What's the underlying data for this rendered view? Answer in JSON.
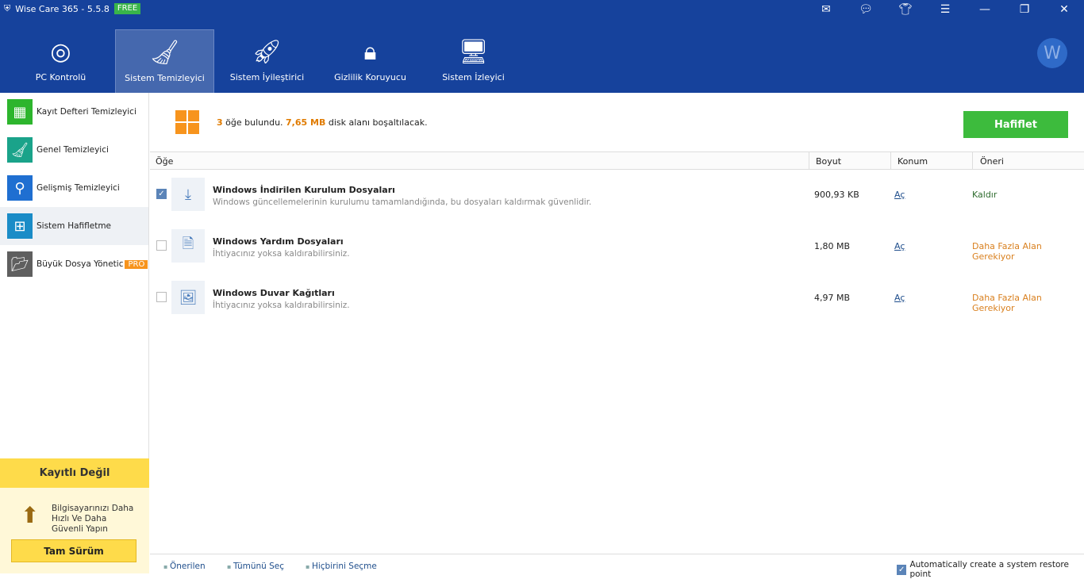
{
  "app": {
    "title": "Wise Care 365 - 5.5.8",
    "badge": "FREE",
    "logo_letter": "W"
  },
  "window_controls": [
    "mail-icon",
    "feedback-icon",
    "skin-icon",
    "menu-icon",
    "minimize-icon",
    "restore-icon",
    "close-icon"
  ],
  "tabs": [
    {
      "label": "PC Kontrolü",
      "icon": "radar-icon"
    },
    {
      "label": "Sistem Temizleyici",
      "icon": "broom-icon",
      "active": true
    },
    {
      "label": "Sistem İyileştirici",
      "icon": "rocket-icon"
    },
    {
      "label": "Gizlilik Koruyucu",
      "icon": "shield-lock-icon"
    },
    {
      "label": "Sistem İzleyici",
      "icon": "monitor-icon"
    }
  ],
  "sidebar": {
    "items": [
      {
        "label": "Kayıt Defteri Temizleyici",
        "color": "#2db52d"
      },
      {
        "label": "Genel Temizleyici",
        "color": "#1aa38a"
      },
      {
        "label": "Gelişmiş Temizleyici",
        "color": "#1f6fd1"
      },
      {
        "label": "Sistem Hafifletme",
        "color": "#1a8cc7",
        "active": true
      },
      {
        "label": "Büyük Dosya Yönetic",
        "color": "#5f5f5f",
        "badge": "PRO"
      }
    ],
    "register": "Kayıtlı Değil",
    "promo": "Bilgisayarınızı Daha Hızlı Ve Daha Güvenli Yapın",
    "full_version": "Tam Sürüm"
  },
  "summary": {
    "count": "3",
    "text1": " öğe bulundu. ",
    "size": "7,65 MB",
    "text2": " disk alanı boşaltılacak.",
    "button": "Hafiflet"
  },
  "columns": [
    "Öğe",
    "Boyut",
    "Konum",
    "Öneri"
  ],
  "rows": [
    {
      "name": "Windows İndirilen Kurulum Dosyaları",
      "desc": "Windows güncellemelerinin kurulumu tamamlandığında, bu dosyaları kaldırmak güvenlidir.",
      "size": "900,93 KB",
      "location": "Aç",
      "suggestion": "Kaldır",
      "suggestion_color": "#2e6b2e",
      "checked": true
    },
    {
      "name": "Windows Yardım Dosyaları",
      "desc": "İhtiyacınız yoksa kaldırabilirsiniz.",
      "size": "1,80 MB",
      "location": "Aç",
      "suggestion": "Daha Fazla Alan Gerekiyor",
      "suggestion_color": "#d9801f",
      "checked": false
    },
    {
      "name": "Windows Duvar Kağıtları",
      "desc": "İhtiyacınız yoksa kaldırabilirsiniz.",
      "size": "4,97 MB",
      "location": "Aç",
      "suggestion": "Daha Fazla Alan Gerekiyor",
      "suggestion_color": "#d9801f",
      "checked": false
    }
  ],
  "footer": {
    "recommended": "Önerilen",
    "select_all": "Tümünü Seç",
    "select_none": "Hiçbirini Seçme",
    "restore_point": "Automatically create a system restore point",
    "restore_checked": true
  }
}
